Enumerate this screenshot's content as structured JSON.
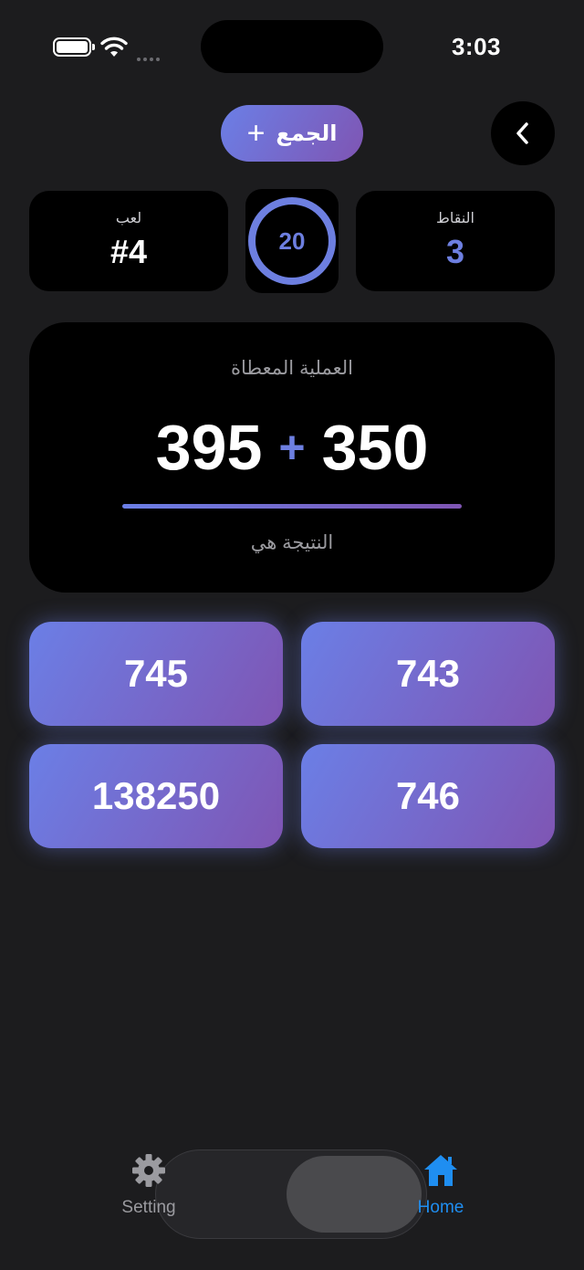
{
  "status_bar": {
    "time": "3:03",
    "battery_icon": "battery-icon",
    "wifi_icon": "wifi-icon",
    "signal_icon": "cellular-signal-icon"
  },
  "header": {
    "operation_label": "الجمع",
    "operation_symbol": "+",
    "back_icon": "chevron-left-icon"
  },
  "stats": {
    "game_label": "لعب",
    "game_value": "#4",
    "score_label": "النقاط",
    "score_value": "3",
    "timer_value": "20"
  },
  "problem": {
    "label": "العملية المعطاة",
    "left_operand": "395",
    "operator": "+",
    "right_operand": "350",
    "result_label": "النتيجة هي"
  },
  "answers": [
    "745",
    "743",
    "138250",
    "746"
  ],
  "tabs": [
    {
      "label": "Setting",
      "icon": "gear-icon"
    },
    {
      "label": "Home",
      "icon": "house-icon"
    }
  ],
  "colors": {
    "background": "#1c1c1e",
    "accent": "#6d7fe0",
    "gradient_start": "#6b7fe6",
    "gradient_end": "#7f55b3",
    "tab_active": "#1f8ef1"
  }
}
